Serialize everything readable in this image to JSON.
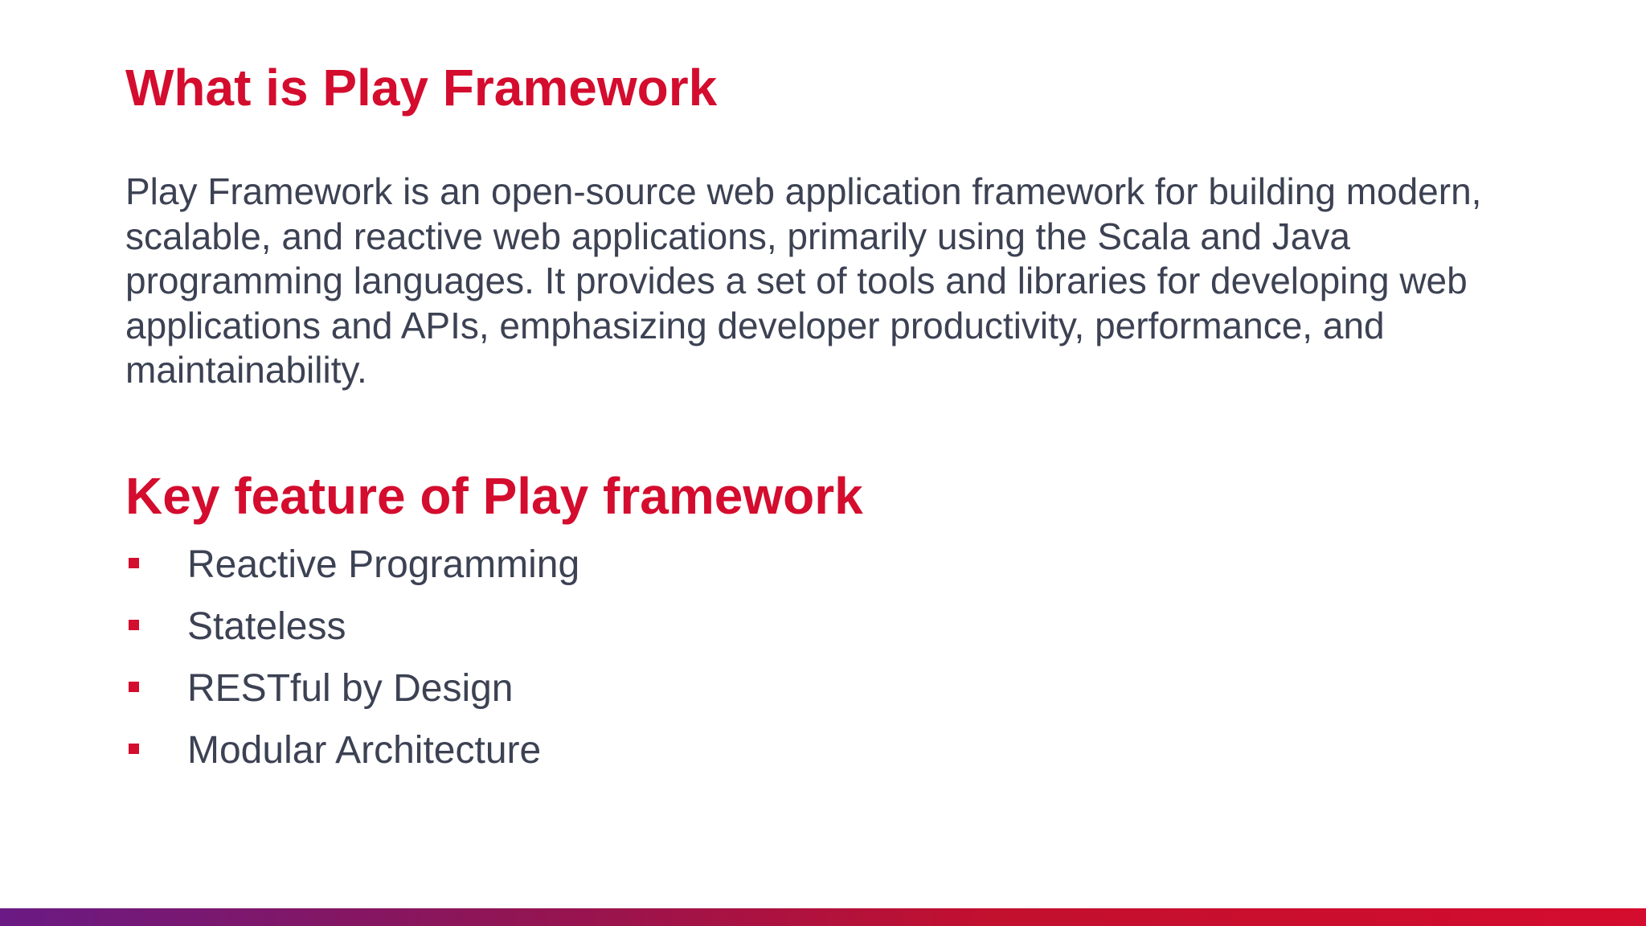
{
  "slide": {
    "title": "What is Play Framework",
    "description": "Play Framework is an open-source web application framework for building modern, scalable, and reactive web applications, primarily using the Scala and Java programming languages. It provides a set of tools and libraries for developing web applications and APIs, emphasizing developer productivity, performance, and maintainability.",
    "features_heading": "Key feature of Play framework",
    "features": [
      {
        "label": "Reactive Programming"
      },
      {
        "label": "Stateless"
      },
      {
        "label": "RESTful by Design"
      },
      {
        "label": "Modular Architecture"
      }
    ]
  },
  "colors": {
    "accent": "#d40c2e",
    "body_text": "#3c4253",
    "bar_start": "#6a1a84",
    "bar_end": "#d40c2e"
  },
  "icons": {
    "bullet": "square-bullet-icon"
  }
}
